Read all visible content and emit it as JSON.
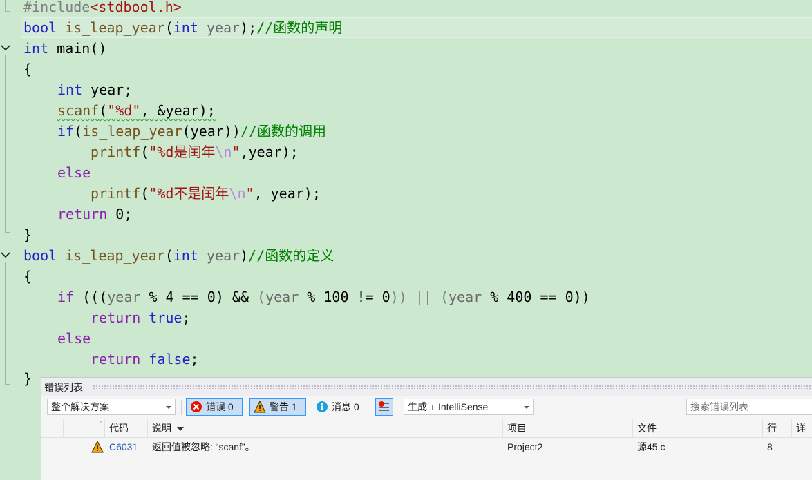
{
  "editor": {
    "lines": {
      "l0": {
        "include": "#include",
        "header": "<stdbool.h>"
      },
      "l1": {
        "bool": "bool",
        "name": "is_leap_year",
        "open": "(",
        "int": "int",
        "param": "year",
        "close": ");",
        "comment": "//函数的声明"
      },
      "l2": {
        "int": "int",
        "main": "main()"
      },
      "l3": {
        "brace": "{"
      },
      "l4": {
        "int": "int",
        "rest": "year;"
      },
      "l5": {
        "fn": "scanf",
        "open": "(",
        "str": "\"%d\"",
        "rest": ", &year);"
      },
      "l6": {
        "if": "if",
        "open": "(",
        "fn": "is_leap_year",
        "args": "(year))",
        "comment": "//函数的调用"
      },
      "l7": {
        "fn": "printf",
        "open": "(",
        "str1": "\"%d是闰年",
        "esc": "\\n",
        "str2": "\"",
        "rest": ",year);"
      },
      "l8": {
        "else": "else"
      },
      "l9": {
        "fn": "printf",
        "open": "(",
        "str1": "\"%d不是闰年",
        "esc": "\\n",
        "str2": "\"",
        "rest": ", year);"
      },
      "l10": {
        "return": "return",
        "rest": "0;"
      },
      "l11": {
        "brace": "}"
      },
      "l12": {
        "bool": "bool",
        "name": "is_leap_year",
        "open": "(",
        "int": "int",
        "param": "year",
        "close": ")",
        "comment": "//函数的定义"
      },
      "l13": {
        "brace": "{"
      },
      "l14": {
        "if": "if",
        "p1": " (((",
        "y1": "year",
        "m1": " % 4 == 0",
        "c1": ")",
        "and": " && ",
        "p2": "(",
        "y2": "year",
        "m2": " % 100 != 0",
        "c2": "))",
        "or": " || ",
        "p3": "(",
        "y3": "year",
        "m3": " % 400 == 0",
        "c3": "))"
      },
      "l15": {
        "return": "return",
        "val": "true",
        "semi": ";"
      },
      "l16": {
        "else": "else"
      },
      "l17": {
        "return": "return",
        "val": "false",
        "semi": ";"
      },
      "l18": {
        "brace": "}"
      }
    }
  },
  "error_list": {
    "title": "错误列表",
    "scope": "整个解决方案",
    "errors_label": "错误 0",
    "warnings_label": "警告 1",
    "messages_label": "消息 0",
    "build_filter": "生成 + IntelliSense",
    "search_placeholder": "搜索错误列表",
    "columns": {
      "code": "代码",
      "description": "说明",
      "project": "项目",
      "file": "文件",
      "line": "行",
      "detail": "详细"
    },
    "rows": [
      {
        "code": "C6031",
        "description": "返回值被忽略: “scanf”。",
        "project": "Project2",
        "file": "源45.c",
        "line": "8"
      }
    ]
  },
  "colors": {
    "editor_bg": "#cce8cf",
    "keyword": "#2323c8",
    "comment": "#008000",
    "string": "#a31515"
  }
}
